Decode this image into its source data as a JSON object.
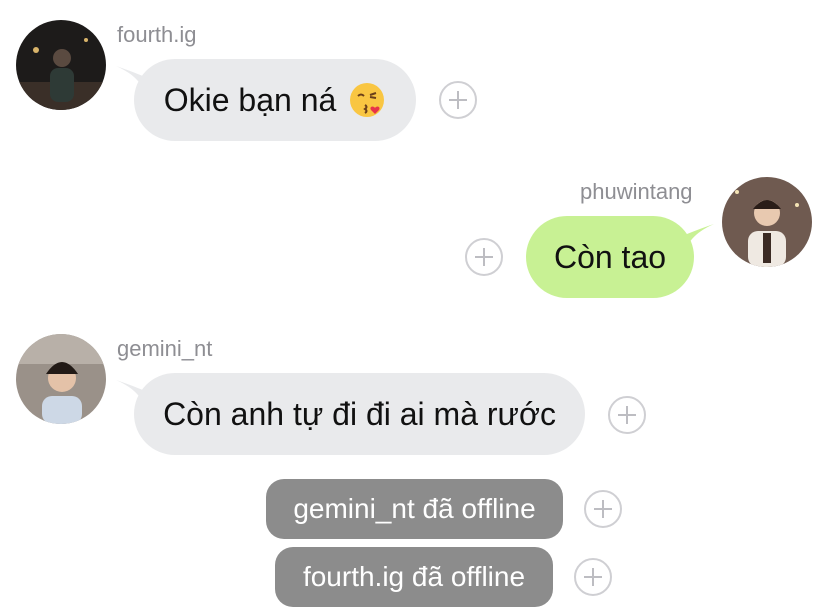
{
  "messages": [
    {
      "sender": "fourth.ig",
      "text": "Okie bạn ná",
      "emoji": "face-blowing-kiss"
    },
    {
      "sender": "phuwintang",
      "text": "Còn tao"
    },
    {
      "sender": "gemini_nt",
      "text": "Còn anh tự đi đi ai mà rước"
    }
  ],
  "system_notices": [
    "gemini_nt đã offline",
    "fourth.ig đã offline"
  ],
  "colors": {
    "incoming_bubble": "#e9eaec",
    "outgoing_bubble": "#c8f194",
    "system_notice": "#8c8c8c",
    "sender_name": "#8e8e93"
  }
}
